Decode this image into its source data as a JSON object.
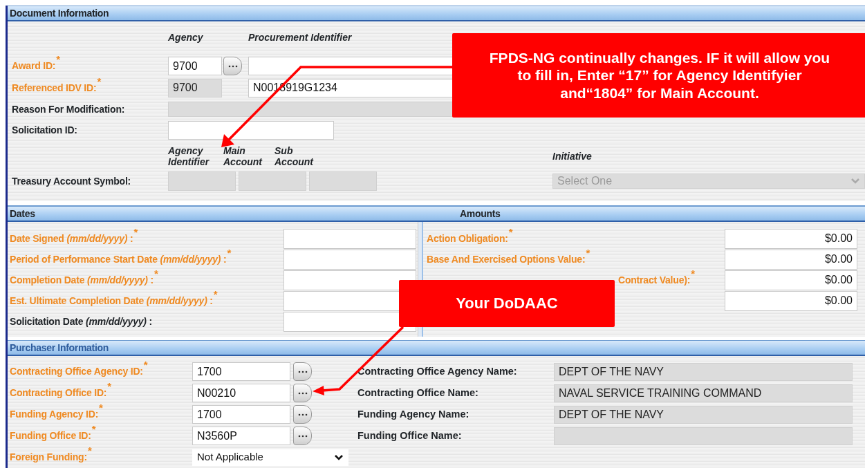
{
  "document_information": {
    "title": "Document Information",
    "column_headers": [
      "Agency",
      "Procurement Identifier"
    ],
    "id_rows": [
      {
        "kind": "lookup",
        "label": "Award ID:",
        "required_mark": "*",
        "agency": "9700"
      },
      {
        "kind": "readonly",
        "label": "Referenced IDV ID:",
        "required_mark": "*",
        "agency": "9700",
        "procurement_identifier": "N0018919G1234"
      }
    ],
    "reason_for_modification": {
      "label": "Reason For Modification:",
      "disabled": true
    },
    "solicitation_id": {
      "label": "Solicitation ID:"
    },
    "treasury_account_symbol": {
      "label": "Treasury Account Symbol:",
      "columns": [
        "Agency Identifier",
        "Main Account",
        "Sub Account"
      ],
      "disabled": true
    },
    "initiative": {
      "label": "Initiative",
      "placeholder": "Select One",
      "disabled": true
    }
  },
  "dates": {
    "title": "Dates",
    "rows": [
      {
        "label": "Date Signed *(mm/dd/yyyy)* :",
        "required_mark": "*"
      },
      {
        "label": "Period of Performance Start Date *(mm/dd/yyyy)* :",
        "required_mark": "*"
      },
      {
        "label": "Completion Date *(mm/dd/yyyy)* :",
        "required_mark": "*"
      },
      {
        "label": "Est. Ultimate Completion Date *(mm/dd/yyyy)* :",
        "required_mark": "*"
      },
      {
        "label": "Solicitation Date *(mm/dd/yyyy)* :"
      }
    ]
  },
  "amounts": {
    "title": "Amounts",
    "rows": [
      {
        "label": "Action Obligation:",
        "required_mark": "*",
        "value": "$0.00"
      },
      {
        "label": "Base And Exercised Options Value:",
        "required_mark": "*",
        "value": "$0.00"
      },
      {
        "label": "Contract Value):",
        "required_mark": "*",
        "partial": true,
        "value": "$0.00"
      },
      {
        "value": "$0.00"
      }
    ]
  },
  "purchaser_information": {
    "title": "Purchaser Information",
    "rows": [
      {
        "label": "Contracting Office Agency ID:",
        "required_mark": "*",
        "value": "1700",
        "name_label": "Contracting Office Agency Name:",
        "name_value": "DEPT OF THE NAVY"
      },
      {
        "label": "Contracting Office ID:",
        "required_mark": "*",
        "value": "N00210",
        "name_label": "Contracting Office Name:",
        "name_value": "NAVAL SERVICE TRAINING COMMAND"
      },
      {
        "label": "Funding Agency ID:",
        "required_mark": "*",
        "value": "1700",
        "name_label": "Funding Agency Name:",
        "name_value": "DEPT OF THE NAVY"
      },
      {
        "label": "Funding Office ID:",
        "required_mark": "*",
        "value": "N3560P",
        "name_label": "Funding Office Name:"
      }
    ],
    "foreign_funding": {
      "label": "Foreign Funding:",
      "required_mark": "*",
      "value": "Not Applicable"
    }
  },
  "callouts": [
    {
      "text": "FPDS-NG continually changes.  IF it will allow you to fill in, Enter “17” for Agency Identifyier and“1804” for Main Account."
    },
    {
      "text": "Your DoDAAC"
    }
  ]
}
